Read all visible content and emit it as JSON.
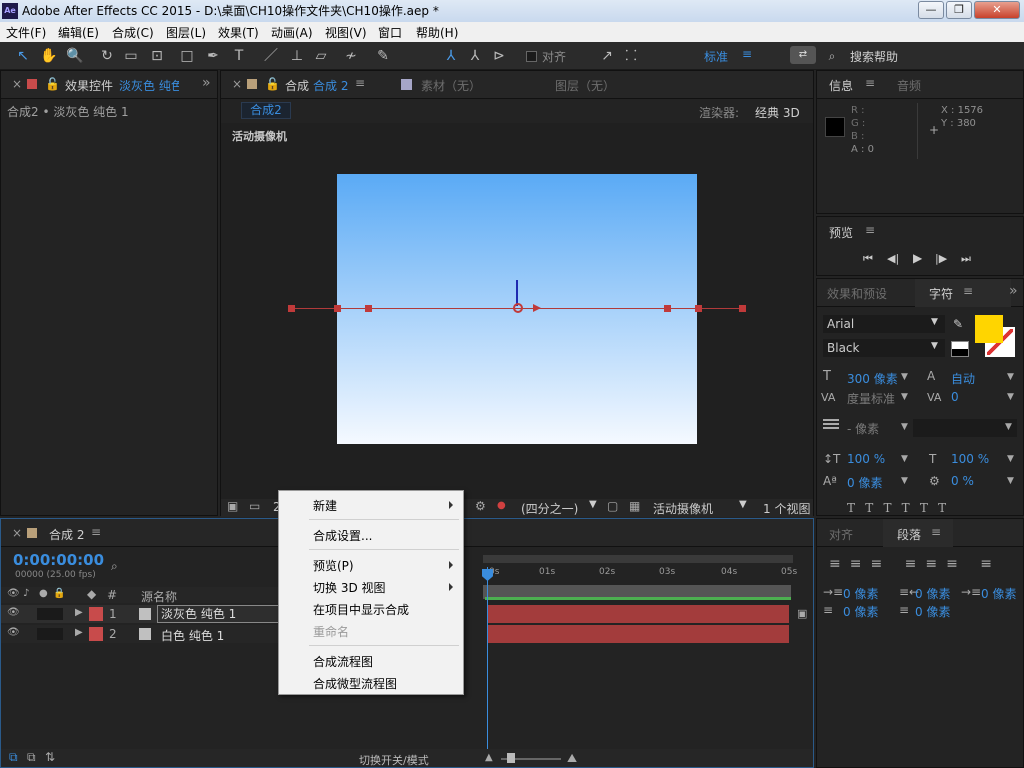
{
  "window": {
    "app_icon": "Ae",
    "title": "Adobe After Effects CC 2015 - D:\\桌面\\CH10操作文件夹\\CH10操作.aep *"
  },
  "menu": [
    "文件(F)",
    "编辑(E)",
    "合成(C)",
    "图层(L)",
    "效果(T)",
    "动画(A)",
    "视图(V)",
    "窗口",
    "帮助(H)"
  ],
  "toolbar": {
    "snap_label": "对齐",
    "workspace": "标准",
    "search": "搜索帮助"
  },
  "effects_panel": {
    "tab": "效果控件",
    "tab_target": "淡灰色 纯色",
    "breadcrumb": "合成2 • 淡灰色 纯色 1"
  },
  "comp_panel": {
    "tab_label": "合成",
    "tab_name": "合成 2",
    "footage_tab": "素材（无）",
    "layer_tab": "图层（无）",
    "comp_chip": "合成2",
    "renderer_label": "渲染器:",
    "renderer_value": "经典 3D",
    "camera_label": "活动摄像机",
    "zoom_value": "2",
    "resolution": "(四分之一)",
    "camera_select": "活动摄像机",
    "views": "1 个视图"
  },
  "info_panel": {
    "tab": "信息",
    "audio_tab": "音频",
    "r": "R :",
    "g": "G :",
    "b": "B :",
    "a": "A : 0",
    "x": "X : 1576",
    "y": "Y : 380"
  },
  "preview_panel": {
    "tab": "预览"
  },
  "character_panel": {
    "effects_tab": "效果和预设",
    "tab": "字符",
    "font": "Arial",
    "style": "Black",
    "size": "300 像素",
    "leading": "自动",
    "kerning": "度量标准",
    "tracking": "0",
    "stroke": "- 像素",
    "vscale": "100 %",
    "hscale": "100 %",
    "baseline": "0 像素",
    "tsume": "0 %",
    "fill_color": "#ffd500"
  },
  "paragraph_panel": {
    "align_tab": "对齐",
    "tab": "段落",
    "indent_left": "0 像素",
    "indent_right": "0 像素",
    "indent_first": "0 像素",
    "space_before": "0 像素",
    "space_after": "0 像素"
  },
  "timeline": {
    "tab": "合成 2",
    "timecode": "0:00:00:00",
    "fps": "00000 (25.00 fps)",
    "col_source": "源名称",
    "col_num": "#",
    "layers": [
      {
        "num": "1",
        "name": "淡灰色 纯色 1"
      },
      {
        "num": "2",
        "name": "白色 纯色 1"
      }
    ],
    "ticks": [
      "0s",
      "01s",
      "02s",
      "03s",
      "04s",
      "05s"
    ],
    "footer_toggle": "切换开关/模式"
  },
  "context_menu": {
    "new": "新建",
    "comp_settings": "合成设置...",
    "preview": "预览(P)",
    "switch_3d": "切换 3D 视图",
    "reveal": "在项目中显示合成",
    "rename": "重命名",
    "flowchart": "合成流程图",
    "mini_flowchart": "合成微型流程图"
  },
  "colors": {
    "accent": "#3a8dde",
    "layer1": "#c84b4b",
    "layer2": "#c84b4b",
    "sky_top": "#5aaaf5",
    "sky_bottom": "#f5f9ff",
    "track": "#a33c3c"
  }
}
